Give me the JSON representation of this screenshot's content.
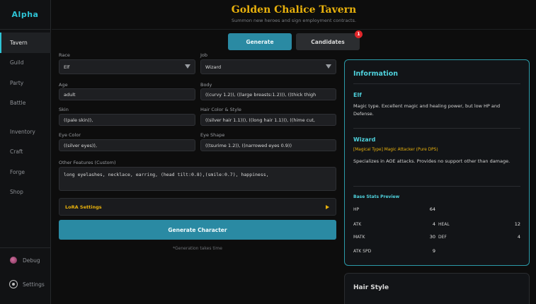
{
  "brand": "Alpha",
  "nav": {
    "items": [
      "Tavern",
      "Guild",
      "Party",
      "Battle",
      "Inventory",
      "Craft",
      "Forge",
      "Shop"
    ],
    "bottom": [
      "Debug",
      "Settings"
    ]
  },
  "header": {
    "title": "Golden Chalice Tavern",
    "subtitle": "Summon new heroes and sign employment contracts."
  },
  "tabs": {
    "generate": "Generate",
    "candidates": "Candidates",
    "candidates_badge": "1"
  },
  "form": {
    "race_label": "Race",
    "race_value": "Elf",
    "job_label": "Job",
    "job_value": "Wizard",
    "age_label": "Age",
    "age_value": "adult",
    "body_label": "Body",
    "body_value": "((curvy 1.2)), ((large breasts:1.2))), ((thick thigh",
    "skin_label": "Skin",
    "skin_value": "((pale skin)),",
    "hair_label": "Hair Color & Style",
    "hair_value": "((silver hair 1.1))), ((long hair 1.1))), ((hime cut,",
    "eye_color_label": "Eye Color",
    "eye_color_value": "((silver eyes)),",
    "eye_shape_label": "Eye Shape",
    "eye_shape_value": "((tsurime 1.2)), ((narrowed eyes 0.9))",
    "other_label": "Other Features (Custom)",
    "other_value": "long eyelashes, necklace, earring, (head tilt:0.8),(smile:0.7), happiness,",
    "lora_label": "LoRA Settings",
    "generate_button": "Generate Character",
    "note": "*Generation takes time"
  },
  "info": {
    "title": "Information",
    "race_name": "Elf",
    "race_desc": "Magic type. Excellent magic and healing power, but low HP and Defense.",
    "job_name": "Wizard",
    "job_type": "[Magical Type] Magic Attacker (Pure DPS)",
    "job_desc": "Specializes in AOE attacks. Provides no support other than damage.",
    "stats_title": "Base Stats Preview",
    "stats": {
      "hp_label": "HP",
      "hp": "64",
      "atk_label": "ATK",
      "atk": "4",
      "heal_label": "HEAL",
      "heal": "12",
      "matk_label": "MATK",
      "matk": "30",
      "def_label": "DEF",
      "def": "4",
      "atkspd_label": "ATK SPD",
      "atkspd": "9"
    }
  },
  "hair_panel": {
    "title": "Hair Style"
  },
  "colors": {
    "accent": "#2a8aa3",
    "gold": "#e8b10c",
    "cyan": "#4fd2dd"
  }
}
